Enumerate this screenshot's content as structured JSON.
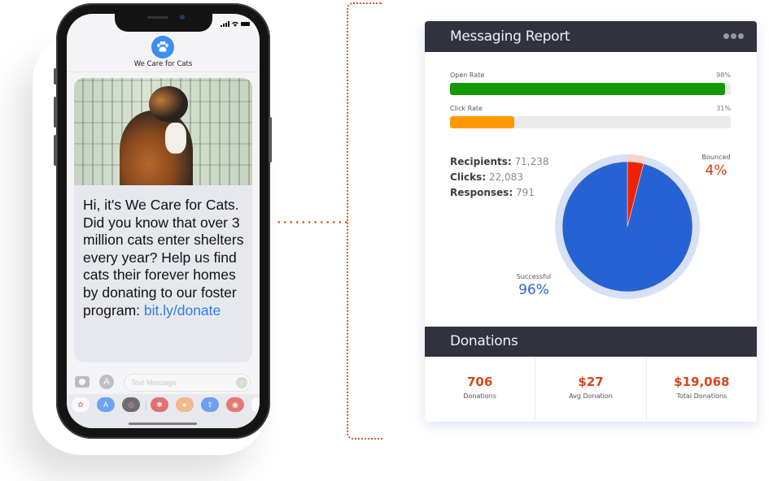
{
  "phone": {
    "contact_name": "We Care for Cats",
    "contact_icon": "paw-icon",
    "message": {
      "image_alt": "calico cat in a shelter cage looking up",
      "text": "Hi, it's We Care for Cats. Did you know that over 3 million cats enter shelters every year? Help us find cats their forever homes by donating to our foster program: ",
      "link": "bit.ly/donate"
    },
    "input_placeholder": "Text Message",
    "status_icons": [
      "signal-icon",
      "wifi-icon",
      "battery-icon"
    ],
    "app_strip": [
      "photos-icon",
      "app-store-icon",
      "activity-icon",
      "yelp-icon",
      "emoji-icon",
      "share-icon",
      "music-icon",
      "more-icon"
    ]
  },
  "report": {
    "title": "Messaging Report",
    "menu_icon": "more-icon",
    "rates": [
      {
        "label": "Open Rate",
        "percent_label": "98%",
        "value": 98,
        "color": "#119a00"
      },
      {
        "label": "Click Rate",
        "percent_label": "31%",
        "value": 23,
        "color": "#ff9800"
      }
    ],
    "stats": [
      {
        "label": "Recipients:",
        "value": "71,238"
      },
      {
        "label": "Clicks:",
        "value": "22,083"
      },
      {
        "label": "Responses:",
        "value": "791"
      }
    ],
    "chart_data": {
      "type": "pie",
      "title": "",
      "slices": [
        {
          "name": "Successful",
          "value": 96,
          "label": "96%",
          "color": "#2563d4"
        },
        {
          "name": "Bounced",
          "value": 4,
          "label": "4%",
          "color": "#ee2200"
        }
      ]
    }
  },
  "donations": {
    "title": "Donations",
    "cells": [
      {
        "value": "706",
        "label": "Donations"
      },
      {
        "value": "$27",
        "label": "Avg Donation"
      },
      {
        "value": "$19,068",
        "label": "Total Donations"
      }
    ]
  },
  "colors": {
    "accent": "#e2572b",
    "header_bg": "#32323f",
    "donation_value": "#d9441c",
    "successful": "#2563d4",
    "bounced": "#ee2200"
  }
}
